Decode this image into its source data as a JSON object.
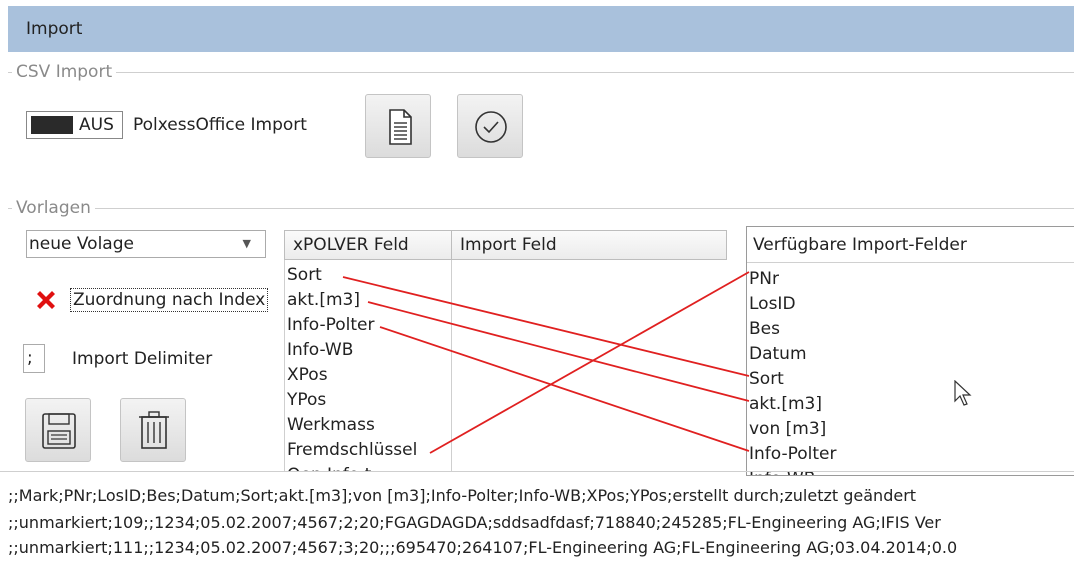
{
  "window": {
    "title": "Import"
  },
  "csv_import": {
    "legend": "CSV Import",
    "toggle_state": "AUS",
    "toggle_label": "PolxessOffice Import"
  },
  "vorlagen": {
    "legend": "Vorlagen",
    "template_select": "neue Volage",
    "mapping_label": "Zuordnung nach Index",
    "delimiter_value": ";",
    "delimiter_label": "Import Delimiter"
  },
  "mapping_table": {
    "headers": [
      "xPOLVER Feld",
      "Import Feld"
    ],
    "fields": [
      "Sort",
      "akt.[m3]",
      "Info-Polter",
      "Info-WB",
      "XPos",
      "YPos",
      "Werkmass",
      "Fremdschlüssel",
      "Oen.Info t"
    ]
  },
  "available_fields": {
    "header": "Verfügbare Import-Felder",
    "items": [
      "PNr",
      "LosID",
      "Bes",
      "Datum",
      "Sort",
      "akt.[m3]",
      "von [m3]",
      "Info-Polter",
      "Info-WB"
    ]
  },
  "connections": [
    {
      "from": "Sort",
      "to": "Sort"
    },
    {
      "from": "akt.[m3]",
      "to": "akt.[m3]"
    },
    {
      "from": "Info-Polter",
      "to": "Info-Polter"
    },
    {
      "from": "Fremdschlüssel",
      "to": "PNr"
    }
  ],
  "csv_preview": [
    ";;Mark;PNr;LosID;Bes;Datum;Sort;akt.[m3];von [m3];Info-Polter;Info-WB;XPos;YPos;erstellt durch;zuletzt geändert",
    ";;unmarkiert;109;;1234;05.02.2007;4567;2;20;FGAGDAGDA;sddsadfdasf;718840;245285;FL-Engineering AG;IFIS Ver",
    ";;unmarkiert;111;;1234;05.02.2007;4567;3;20;;;695470;264107;FL-Engineering AG;FL-Engineering AG;03.04.2014;0.0"
  ],
  "colors": {
    "titlebar": "#a9c1dc",
    "connection_line": "#e02020",
    "delete_mark": "#e01010"
  },
  "icons": [
    "document-icon",
    "check-circle-icon",
    "delete-x-icon",
    "save-icon",
    "trash-icon",
    "dropdown-arrow-icon",
    "mouse-cursor-icon"
  ]
}
